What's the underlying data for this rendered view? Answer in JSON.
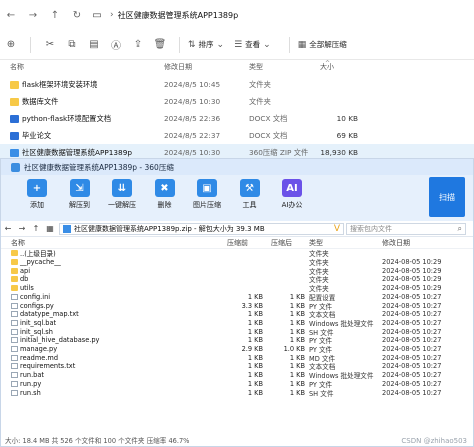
{
  "explorer": {
    "path_root": "社区健康数据管理系统APP1389p",
    "toolbar": {
      "sort_label": "排序",
      "view_label": "查看",
      "extract_label": "全部解压缩"
    },
    "columns": {
      "name": "名称",
      "date": "修改日期",
      "type": "类型",
      "size": "大小"
    },
    "rows": [
      {
        "icon": "folder-icon",
        "name": "flask框架环境安装环境",
        "date": "2024/8/5 10:45",
        "type": "文件夹",
        "size": ""
      },
      {
        "icon": "folder-icon",
        "name": "数据库文件",
        "date": "2024/8/5 10:30",
        "type": "文件夹",
        "size": ""
      },
      {
        "icon": "docx-icon",
        "name": "python-flask环境配置文档",
        "date": "2024/8/5 22:36",
        "type": "DOCX 文档",
        "size": "10 KB"
      },
      {
        "icon": "docx-icon",
        "name": "毕业论文",
        "date": "2024/8/5 22:37",
        "type": "DOCX 文档",
        "size": "69 KB"
      },
      {
        "icon": "zip-icon",
        "name": "社区健康数据管理系统APP1389p",
        "date": "2024/8/5 10:30",
        "type": "360压缩 ZIP 文件",
        "size": "18,930 KB"
      }
    ]
  },
  "zip": {
    "title": "社区健康数据管理系统APP1389p - 360压缩",
    "ribbon": [
      {
        "label": "添加",
        "icon": "add-icon",
        "color": "#2f8ae6"
      },
      {
        "label": "解压到",
        "icon": "extract-to-icon",
        "color": "#2f8ae6"
      },
      {
        "label": "一键解压",
        "icon": "one-click-extract-icon",
        "color": "#2f8ae6"
      },
      {
        "label": "删除",
        "icon": "delete-icon",
        "color": "#2f8ae6"
      },
      {
        "label": "图片压缩",
        "icon": "image-compress-icon",
        "color": "#2f8ae6"
      },
      {
        "label": "工具",
        "icon": "tools-icon",
        "color": "#2f8ae6"
      },
      {
        "label": "AI办公",
        "icon": "ai-office-icon",
        "color": "#6b52e8"
      }
    ],
    "scan_label": "扫描",
    "path_text": "社区健康数据管理系统APP1389p.zip - 解包大小为 39.3 MB",
    "search_placeholder": "搜索包内文件",
    "columns": {
      "name": "名称",
      "size": "压缩前",
      "csize": "压缩后",
      "type": "类型",
      "date": "修改日期"
    },
    "rows": [
      {
        "icon": "folder-icon",
        "name": "..(上级目录)",
        "size": "",
        "csize": "",
        "type": "文件夹",
        "date": ""
      },
      {
        "icon": "folder-icon",
        "name": "__pycache__",
        "size": "",
        "csize": "",
        "type": "文件夹",
        "date": "2024-08-05 10:29"
      },
      {
        "icon": "folder-icon",
        "name": "api",
        "size": "",
        "csize": "",
        "type": "文件夹",
        "date": "2024-08-05 10:29"
      },
      {
        "icon": "folder-icon",
        "name": "db",
        "size": "",
        "csize": "",
        "type": "文件夹",
        "date": "2024-08-05 10:29"
      },
      {
        "icon": "folder-icon",
        "name": "utils",
        "size": "",
        "csize": "",
        "type": "文件夹",
        "date": "2024-08-05 10:29"
      },
      {
        "icon": "file-icon",
        "name": "config.ini",
        "size": "1 KB",
        "csize": "1 KB",
        "type": "配置设置",
        "date": "2024-08-05 10:27"
      },
      {
        "icon": "file-icon",
        "name": "configs.py",
        "size": "3.3 KB",
        "csize": "1 KB",
        "type": "PY 文件",
        "date": "2024-08-05 10:27"
      },
      {
        "icon": "file-icon",
        "name": "datatype_map.txt",
        "size": "1 KB",
        "csize": "1 KB",
        "type": "文本文档",
        "date": "2024-08-05 10:27"
      },
      {
        "icon": "file-icon",
        "name": "init_sql.bat",
        "size": "1 KB",
        "csize": "1 KB",
        "type": "Windows 批处理文件",
        "date": "2024-08-05 10:27"
      },
      {
        "icon": "file-icon",
        "name": "init_sql.sh",
        "size": "1 KB",
        "csize": "1 KB",
        "type": "SH 文件",
        "date": "2024-08-05 10:27"
      },
      {
        "icon": "file-icon",
        "name": "initial_hive_database.py",
        "size": "1 KB",
        "csize": "1 KB",
        "type": "PY 文件",
        "date": "2024-08-05 10:27"
      },
      {
        "icon": "file-icon",
        "name": "manage.py",
        "size": "2.9 KB",
        "csize": "1.0 KB",
        "type": "PY 文件",
        "date": "2024-08-05 10:27"
      },
      {
        "icon": "file-icon",
        "name": "readme.md",
        "size": "1 KB",
        "csize": "1 KB",
        "type": "MD 文件",
        "date": "2024-08-05 10:27"
      },
      {
        "icon": "file-icon",
        "name": "requirements.txt",
        "size": "1 KB",
        "csize": "1 KB",
        "type": "文本文档",
        "date": "2024-08-05 10:27"
      },
      {
        "icon": "file-icon",
        "name": "run.bat",
        "size": "1 KB",
        "csize": "1 KB",
        "type": "Windows 批处理文件",
        "date": "2024-08-05 10:27"
      },
      {
        "icon": "file-icon",
        "name": "run.py",
        "size": "1 KB",
        "csize": "1 KB",
        "type": "PY 文件",
        "date": "2024-08-05 10:27"
      },
      {
        "icon": "file-icon",
        "name": "run.sh",
        "size": "1 KB",
        "csize": "1 KB",
        "type": "SH 文件",
        "date": "2024-08-05 10:27"
      }
    ],
    "status": "大小: 18.4 MB 共 526 个文件和 100 个文件夹 压缩率 46.7%",
    "watermark": "CSDN @zhihao503"
  }
}
